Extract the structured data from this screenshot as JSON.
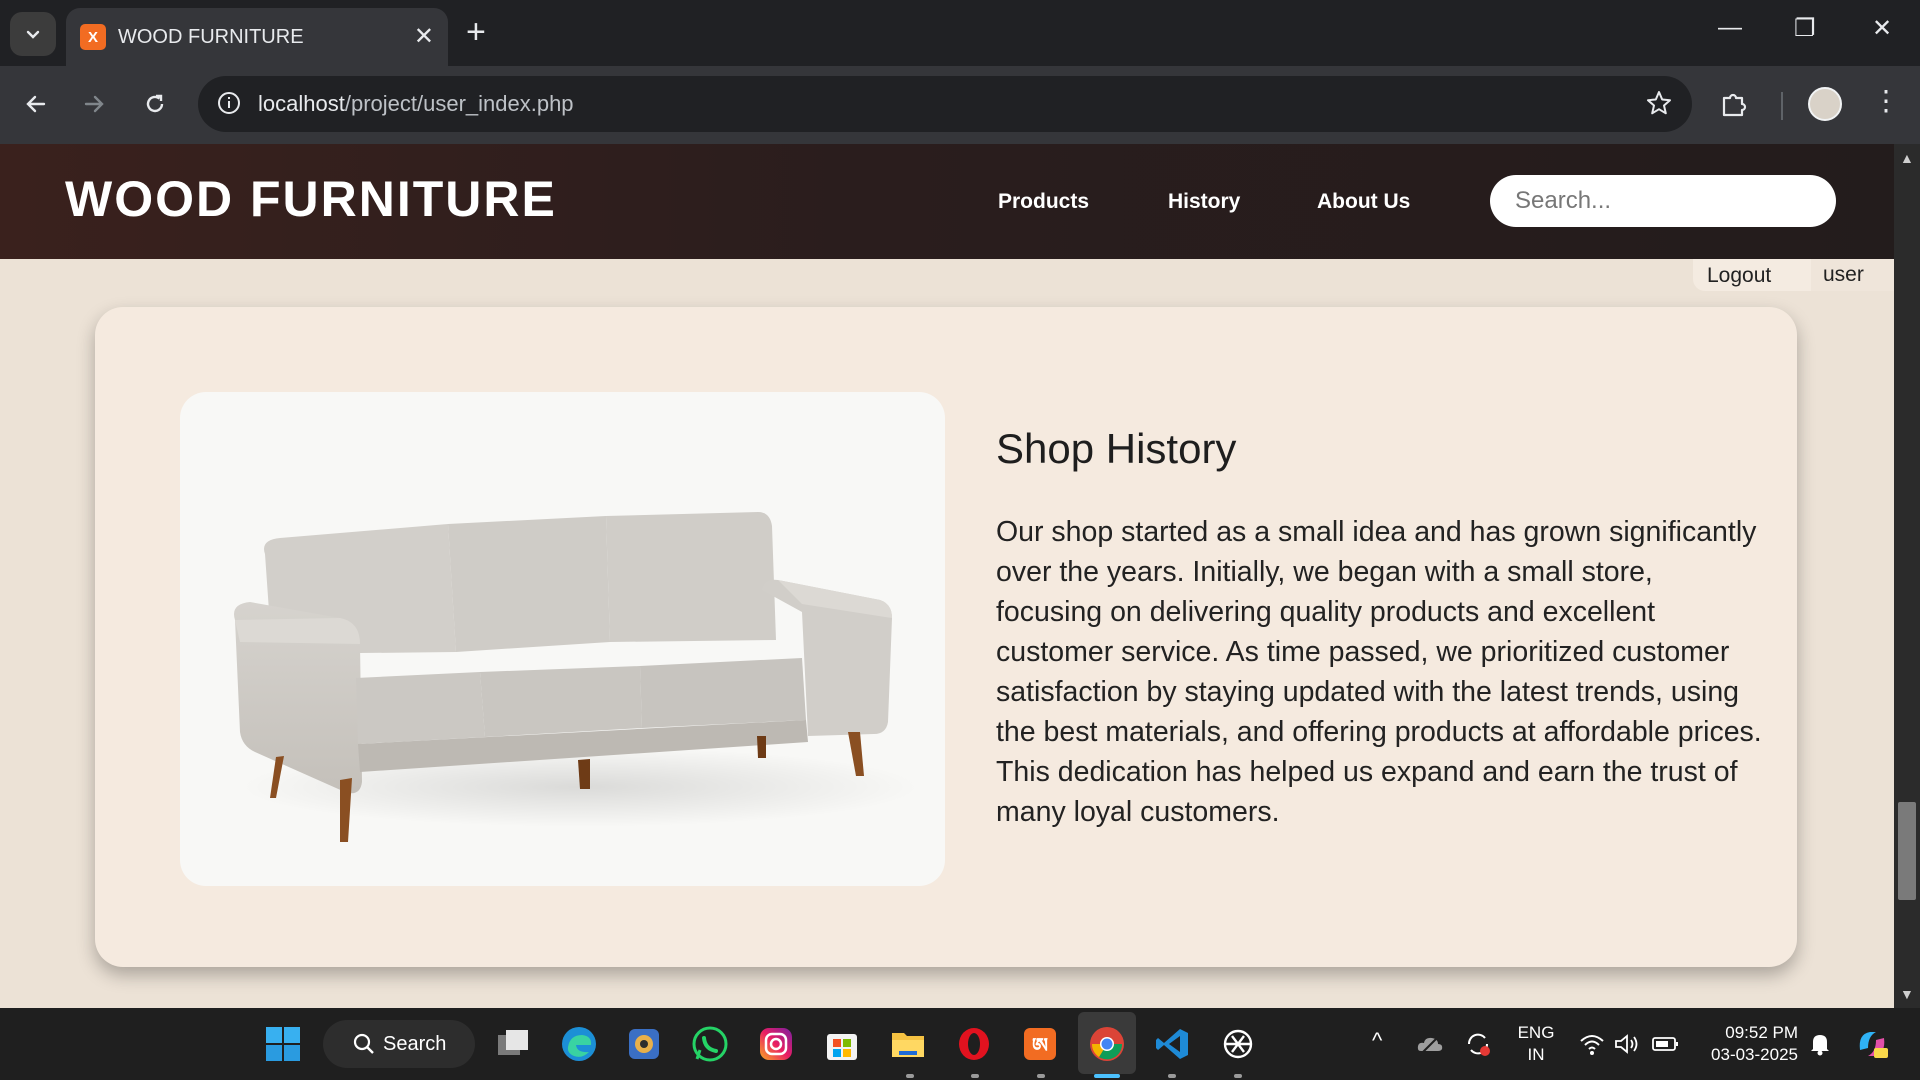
{
  "browser": {
    "tab_title": "WOOD FURNITURE",
    "url_host": "localhost",
    "url_path": "/project/user_index.php"
  },
  "site": {
    "logo": "WOOD FURNITURE",
    "nav": [
      "Products",
      "History",
      "About Us"
    ],
    "search_placeholder": "Search...",
    "logout_label": "Logout",
    "username": "user"
  },
  "history": {
    "title": "Shop History",
    "body": "Our shop started as a small idea and has grown significantly over the years. Initially, we began with a small store, focusing on delivering quality products and excellent customer service. As time passed, we prioritized customer satisfaction by staying updated with the latest trends, using the best materials, and offering products at affordable prices. This dedication has helped us expand and earn the trust of many loyal customers."
  },
  "taskbar": {
    "search_label": "Search",
    "apps": [
      "start-icon",
      "search-icon",
      "task-view-icon",
      "edge-icon",
      "photos-icon",
      "whatsapp-icon",
      "instagram-icon",
      "store-icon",
      "file-explorer-icon",
      "opera-icon",
      "xampp-icon",
      "chrome-icon",
      "vscode-icon",
      "chatgpt-icon"
    ],
    "lang_top": "ENG",
    "lang_bottom": "IN",
    "time": "09:52 PM",
    "date": "03-03-2025"
  },
  "colors": {
    "header_bg": "#2a1d1d",
    "page_bg": "#ece2d6",
    "card_bg": "#f5eadf"
  }
}
